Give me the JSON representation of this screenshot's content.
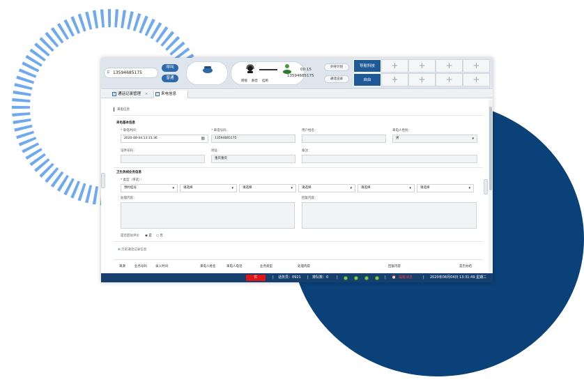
{
  "topbar": {
    "phone_number": "13594685175",
    "call_button": "呼叫",
    "hangup_button": "普通",
    "op_labels": [
      "转接",
      "静音",
      "挂断"
    ],
    "timer": "00:15",
    "caller_number": "13594685175",
    "outbound_plan_button": "外呼计划",
    "call_record_button": "通话记录",
    "status_cells": [
      "导航科技",
      "自由"
    ]
  },
  "tabs": [
    {
      "label": "通话记录管理"
    },
    {
      "label": "来电信息"
    }
  ],
  "content": {
    "breadcrumb": "来电信息",
    "section1_title": "来电基本信息",
    "labels": {
      "call_time": "* 来电时间：",
      "call_number": "* 来电号码：",
      "user_name": "用户姓名：",
      "caller_gender": "来电人性别：",
      "id_number": "证件号码：",
      "address": "地址：",
      "remark": "备注："
    },
    "values": {
      "call_time": "2020-08-04 13:31:36",
      "call_number": "13594685175",
      "caller_gender": "男",
      "address": "重庆重庆"
    },
    "section2_title": "卫生热线业务信息",
    "category_label": "* 类型（单选）：",
    "selects": [
      "预约挂号",
      "请选择",
      "请选择",
      "请选择",
      "请选择",
      "请选择"
    ],
    "handle_content_label": "处理内容：",
    "reply_content_label": "回复内容：",
    "satisfy_label": "是否回访评价",
    "radio_yes": "是",
    "radio_no": "否",
    "history_expander": "历史通话记录信息",
    "table_headers": [
      "来源",
      "业务号码",
      "录入时间",
      "来电人姓名",
      "来电人电话",
      "业务类型",
      "处理内容",
      "回复内容",
      "是否办结"
    ]
  },
  "statusbar": {
    "busy": "忙",
    "agent": "话务员：0921",
    "queue": "排队数：0",
    "alarm": "提醒消息",
    "datetime": "2020年08月04日 13:31:49 星期二"
  },
  "colors": {
    "navy": "#0a4178",
    "ring": "#6fa9f0",
    "accent": "#2f6aa8",
    "busy": "#e01515"
  }
}
